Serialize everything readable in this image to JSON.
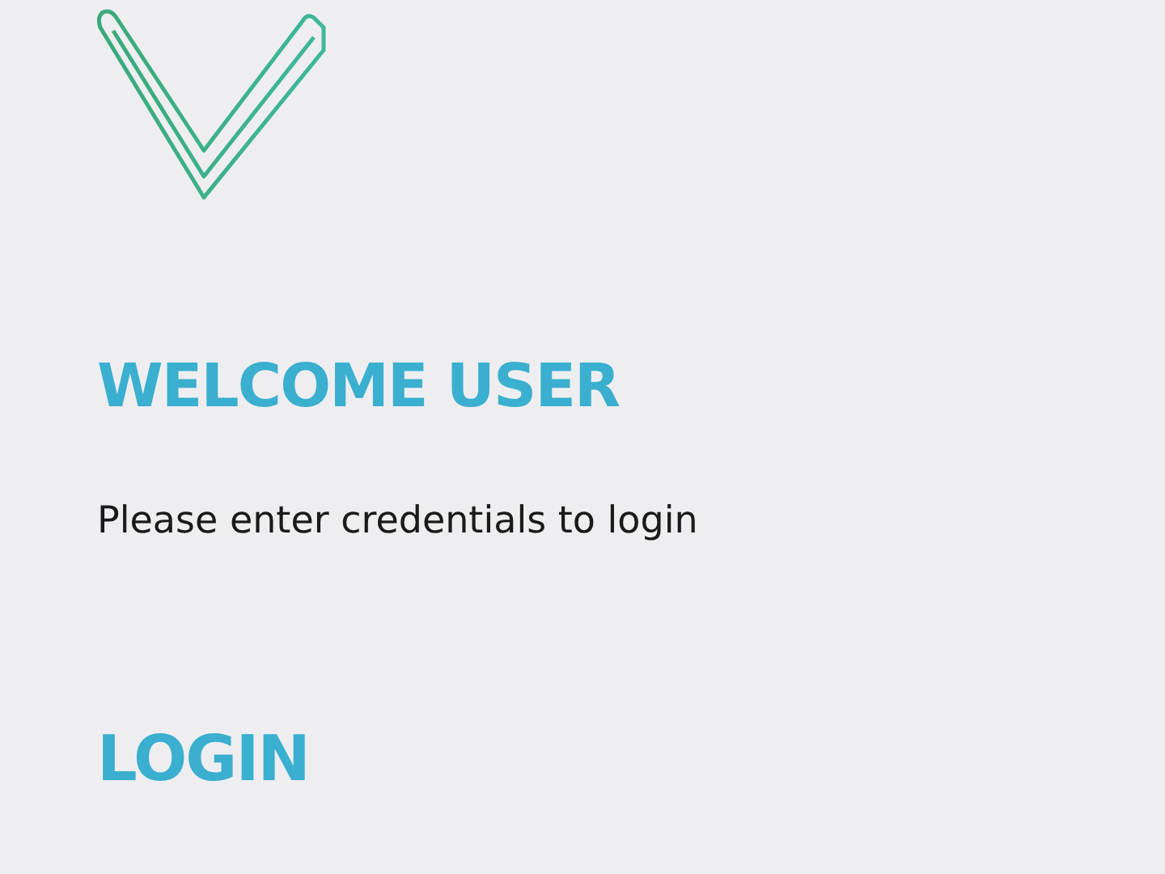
{
  "heading": "WELCOME USER",
  "message": "Please enter credentials to login",
  "section_title": "LOGIN"
}
